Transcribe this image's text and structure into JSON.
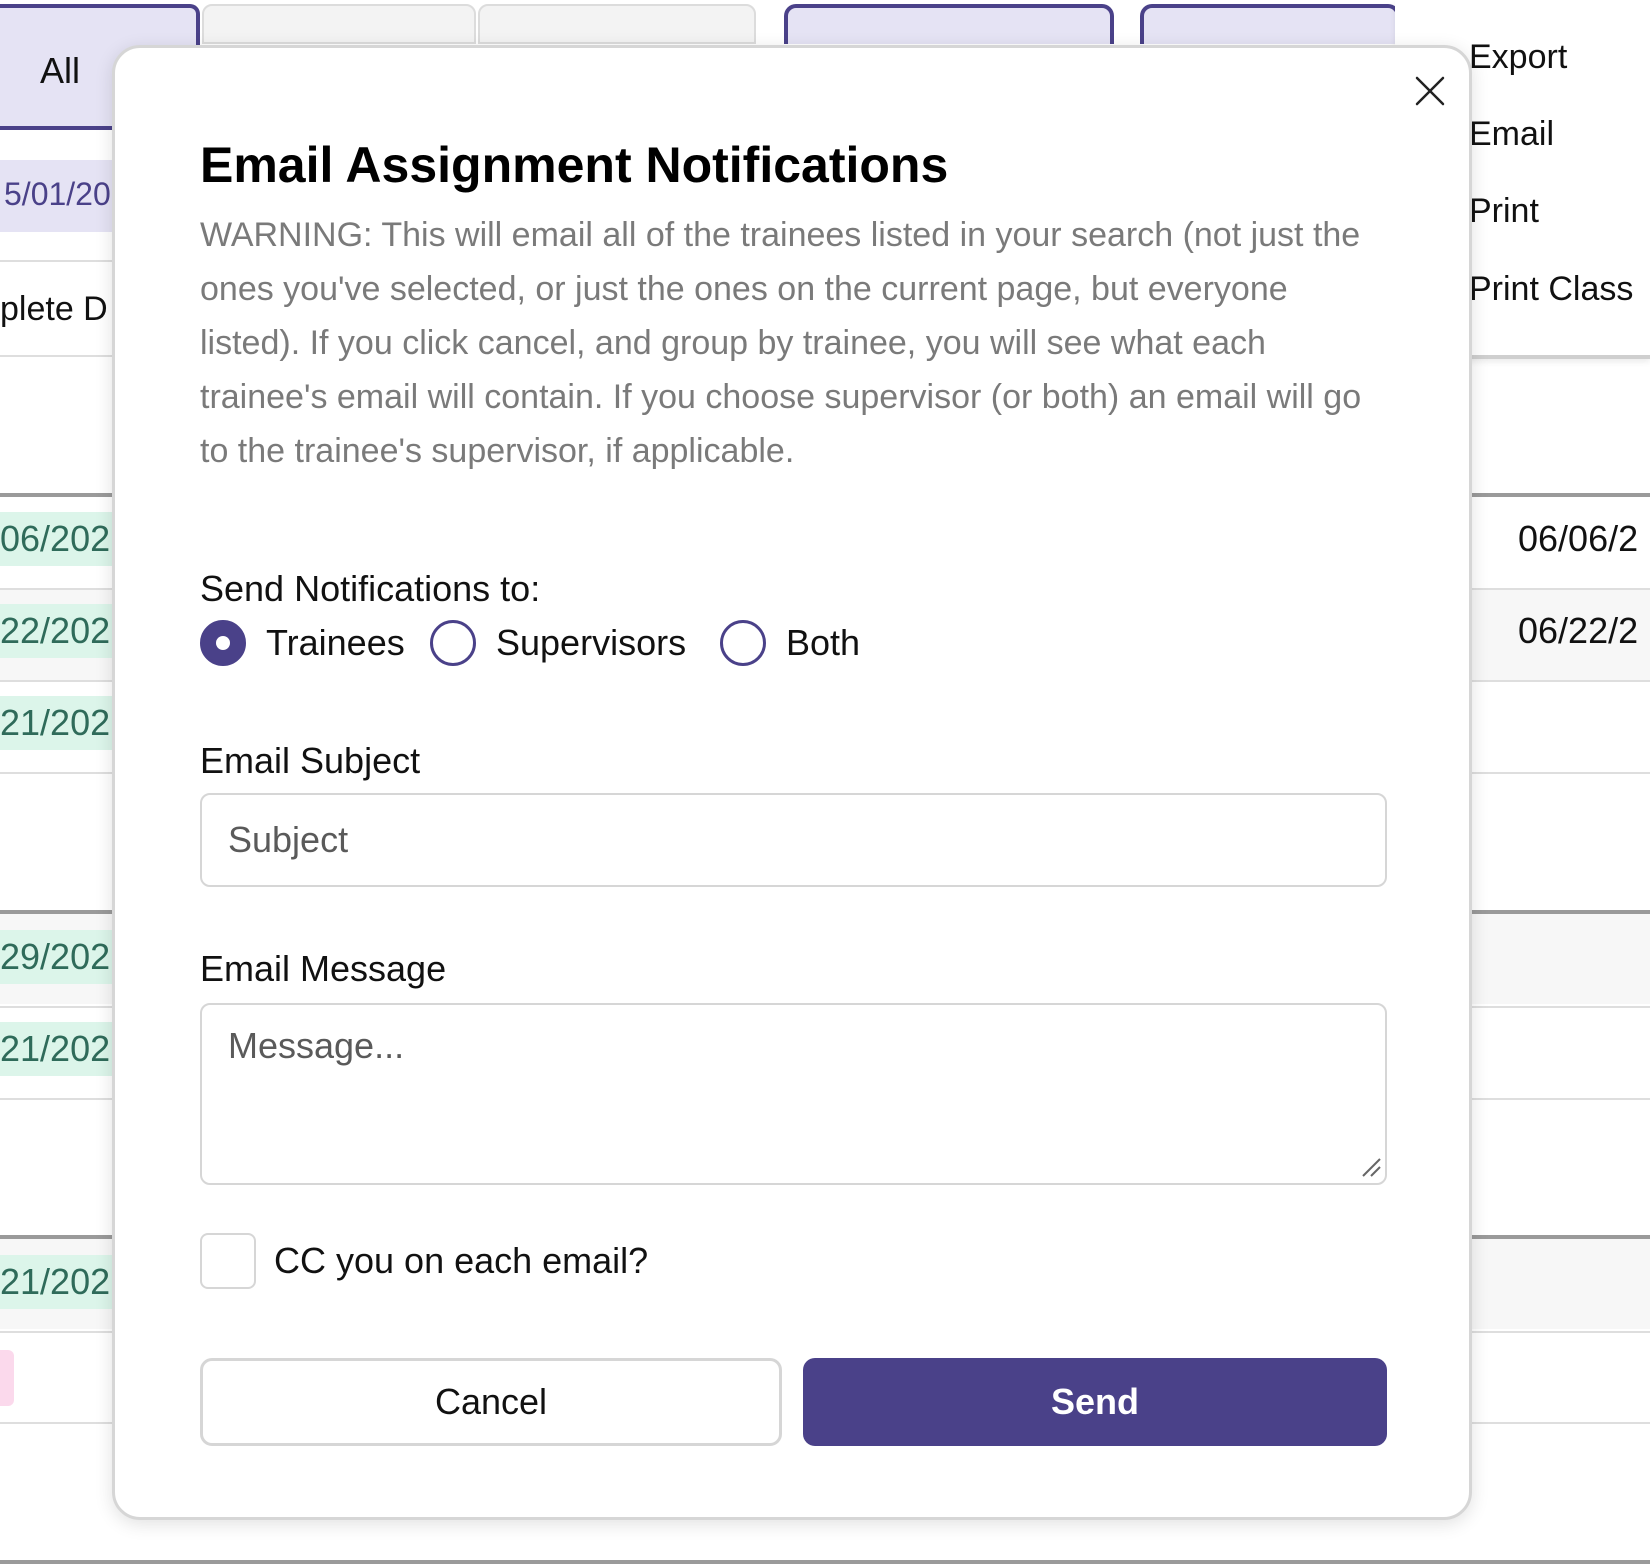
{
  "background": {
    "tab_all_label": "All",
    "left_date_highlight": "5/01/20",
    "left_column_header": "plete D",
    "left_dates": [
      "06/202",
      "22/202",
      "21/202",
      "29/202",
      "21/202",
      "21/202"
    ],
    "right_dates": [
      "06/06/2",
      "06/22/2"
    ],
    "menu": {
      "items": [
        "Export",
        "Email",
        "Print",
        "Print Class"
      ]
    }
  },
  "modal": {
    "title": "Email Assignment Notifications",
    "warning": "WARNING: This will email all of the trainees listed in your search (not just the ones you've selected, or just the ones on the current page, but everyone listed). If you click cancel, and group by trainee, you will see what each trainee's email will contain. If you choose supervisor (or both) an email will go to the trainee's supervisor, if applicable.",
    "send_to_label": "Send Notifications to:",
    "radio_options": [
      {
        "label": "Trainees",
        "checked": true
      },
      {
        "label": "Supervisors",
        "checked": false
      },
      {
        "label": "Both",
        "checked": false
      }
    ],
    "subject_label": "Email Subject",
    "subject_placeholder": "Subject",
    "subject_value": "",
    "message_label": "Email Message",
    "message_placeholder": "Message...",
    "message_value": "",
    "cc_label": "CC you on each email?",
    "cc_checked": false,
    "cancel_label": "Cancel",
    "send_label": "Send"
  },
  "colors": {
    "primary": "#4a4189",
    "primary_light": "#e5e3f4",
    "warning_text": "#7a7a7a",
    "date_green_bg": "#dcf5ea"
  }
}
